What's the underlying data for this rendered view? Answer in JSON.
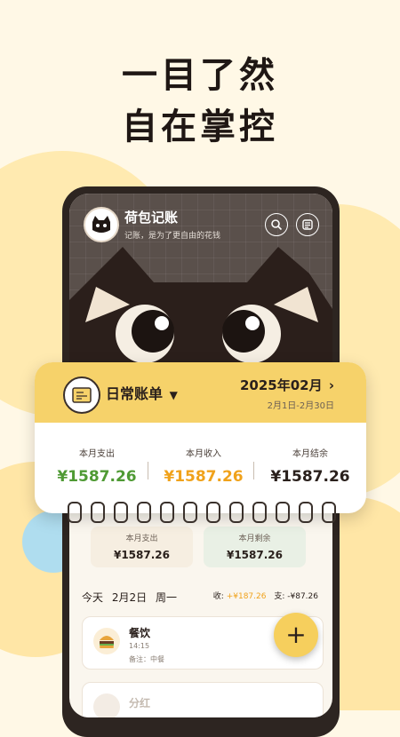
{
  "hero": {
    "line1": "一目了然",
    "line2": "自在掌控"
  },
  "app": {
    "title": "荷包记账",
    "subtitle": "记账，是为了更自由的花钱",
    "icons": {
      "search": "search-icon",
      "list": "list-icon"
    }
  },
  "ledger": {
    "name": "日常账单",
    "month": "2025年02月",
    "range": "2月1日-2月30日",
    "stats": [
      {
        "label": "本月支出",
        "value": "¥1587.26",
        "color": "#4f9a34"
      },
      {
        "label": "本月收入",
        "value": "¥1587.26",
        "color": "#f0a21b"
      },
      {
        "label": "本月结余",
        "value": "¥1587.26",
        "color": "#2a201c"
      }
    ]
  },
  "summary": [
    {
      "label": "本月支出",
      "value": "¥1587.26"
    },
    {
      "label": "本月剩余",
      "value": "¥1587.26"
    }
  ],
  "today": {
    "label": "今天",
    "date": "2月2日",
    "weekday": "周一",
    "income_label": "收: ",
    "income": "+¥187.26",
    "expense_label": "支: ",
    "expense": "-¥87.26"
  },
  "entries": [
    {
      "category": "餐饮",
      "time": "14:15",
      "note_label": "备注：",
      "note": "中餐",
      "amount": "-"
    },
    {
      "category": "分红",
      "time": "",
      "note_label": "",
      "note": "",
      "amount": ""
    }
  ],
  "fab_label": "+"
}
